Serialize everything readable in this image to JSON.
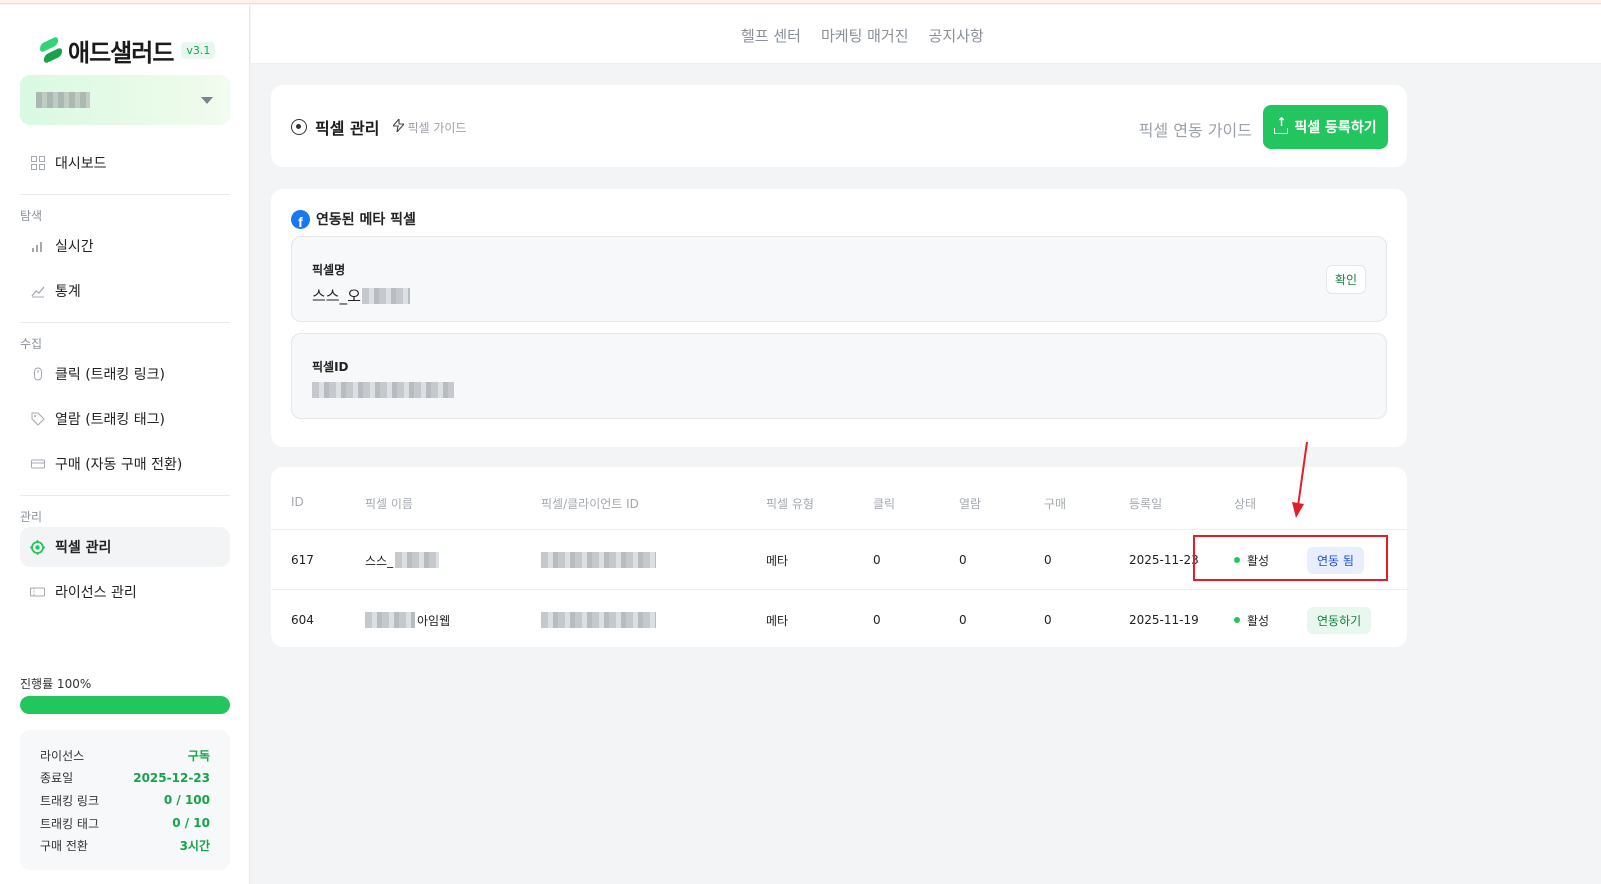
{
  "app": {
    "name": "애드샐러드",
    "version": "v3.1"
  },
  "sidebar": {
    "items_top": [
      {
        "label": "대시보드"
      }
    ],
    "sections": [
      {
        "label": "탐색",
        "items": [
          {
            "label": "실시간"
          },
          {
            "label": "통계"
          }
        ]
      },
      {
        "label": "수집",
        "items": [
          {
            "label": "클릭 (트래킹 링크)"
          },
          {
            "label": "열람 (트래킹 태그)"
          },
          {
            "label": "구매 (자동 구매 전환)"
          }
        ]
      },
      {
        "label": "관리",
        "items": [
          {
            "label": "픽셀 관리",
            "active": true
          },
          {
            "label": "라이선스 관리"
          }
        ]
      }
    ],
    "progress": {
      "label": "진행률 100%",
      "value": 1.0
    },
    "license": [
      {
        "key": "라이선스",
        "value": "구독"
      },
      {
        "key": "종료일",
        "value": "2025-12-23"
      },
      {
        "key": "트래킹 링크",
        "value": "0 / 100"
      },
      {
        "key": "트래킹 태그",
        "value": "0 / 10"
      },
      {
        "key": "구매 전환",
        "value": "3시간"
      }
    ]
  },
  "header": {
    "links": [
      "헬프 센터",
      "마케팅 매거진",
      "공지사항"
    ]
  },
  "page": {
    "title": "픽셀 관리",
    "guide_link": "픽셀 가이드",
    "guide_right": "픽셀 연동 가이드",
    "register_button": "픽셀 등록하기"
  },
  "meta": {
    "title": "연동된 메타 픽셀",
    "name_label": "픽셀명",
    "name_value": "스스_오",
    "confirm_button": "확인",
    "id_label": "픽셀ID"
  },
  "table": {
    "headers": [
      "ID",
      "픽셀 이름",
      "픽셀/클라이언트 ID",
      "픽셀 유형",
      "클릭",
      "열람",
      "구매",
      "등록일",
      "상태"
    ],
    "rows": [
      {
        "id": "617",
        "name": "스스_",
        "type": "메타",
        "click": "0",
        "view": "0",
        "purchase": "0",
        "date": "2025-11-23",
        "status": "활성",
        "action": "연동 됨"
      },
      {
        "id": "604",
        "name": "아임웹",
        "type": "메타",
        "click": "0",
        "view": "0",
        "purchase": "0",
        "date": "2025-11-19",
        "status": "활성",
        "action": "연동하기"
      }
    ]
  },
  "colors": {
    "accent": "#22c55e",
    "linked": "#1d4ed8",
    "highlight": "#e11d2a"
  }
}
